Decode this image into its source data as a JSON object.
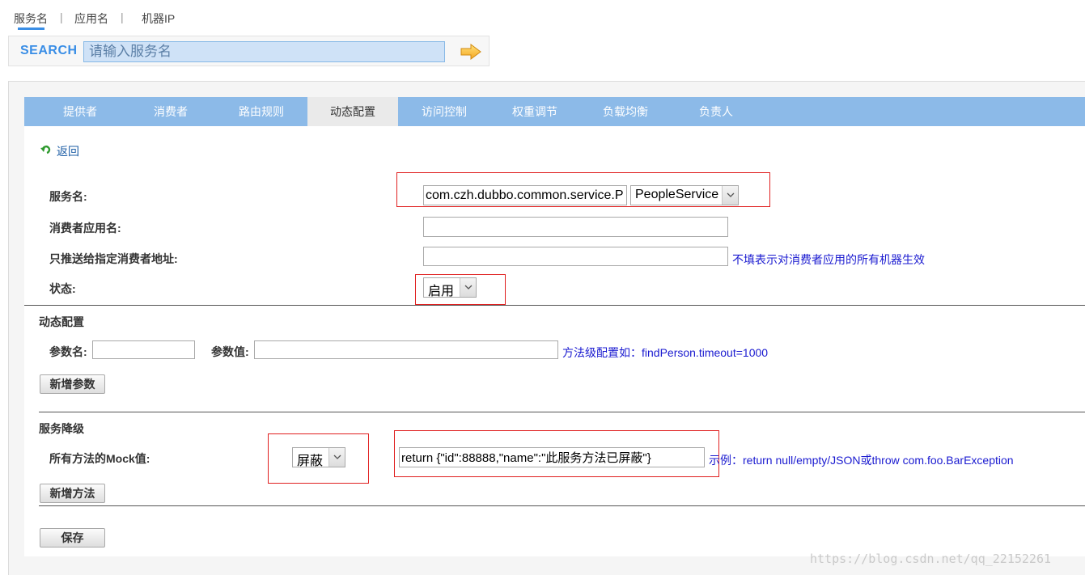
{
  "search_tabs": [
    {
      "label": "服务名",
      "active": true
    },
    {
      "label": "应用名",
      "active": false
    },
    {
      "label": "机器IP",
      "active": false
    }
  ],
  "search": {
    "label": "SEARCH",
    "placeholder": "请输入服务名",
    "go_icon": "arrow-right-icon"
  },
  "nav_tabs": [
    {
      "label": "提供者",
      "active": false
    },
    {
      "label": "消费者",
      "active": false
    },
    {
      "label": "路由规则",
      "active": false
    },
    {
      "label": "动态配置",
      "active": true
    },
    {
      "label": "访问控制",
      "active": false
    },
    {
      "label": "权重调节",
      "active": false
    },
    {
      "label": "负载均衡",
      "active": false
    },
    {
      "label": "负责人",
      "active": false
    }
  ],
  "back": {
    "label": "返回",
    "icon": "return-arrow-icon"
  },
  "form": {
    "service_name_label": "服务名:",
    "service_name_value": "com.czh.dubbo.common.service.P",
    "service_select_value": "PeopleService",
    "consumer_app_label": "消费者应用名:",
    "consumer_app_value": "",
    "consumer_addr_label": "只推送给指定消费者地址:",
    "consumer_addr_value": "",
    "consumer_addr_hint": "不填表示对消费者应用的所有机器生效",
    "status_label": "状态:",
    "status_value": "启用"
  },
  "dynamic_config": {
    "title": "动态配置",
    "param_name_label": "参数名:",
    "param_name_value": "",
    "param_value_label": "参数值:",
    "param_value_value": "",
    "hint": "方法级配置如：findPerson.timeout=1000",
    "add_button": "新增参数"
  },
  "degrade": {
    "title": "服务降级",
    "mock_label": "所有方法的Mock值:",
    "mock_select_value": "屏蔽",
    "mock_value": "return {\"id\":88888,\"name\":\"此服务方法已屏蔽\"}",
    "hint": "示例：return null/empty/JSON或throw com.foo.BarException",
    "add_button": "新增方法"
  },
  "save_button": "保存",
  "watermark": "https://blog.csdn.net/qq_22152261",
  "colors": {
    "accent": "#3a8ee6",
    "tabbar": "#8cbae8",
    "hint_text": "#1a1ad0",
    "highlight_box": "#e02020"
  }
}
